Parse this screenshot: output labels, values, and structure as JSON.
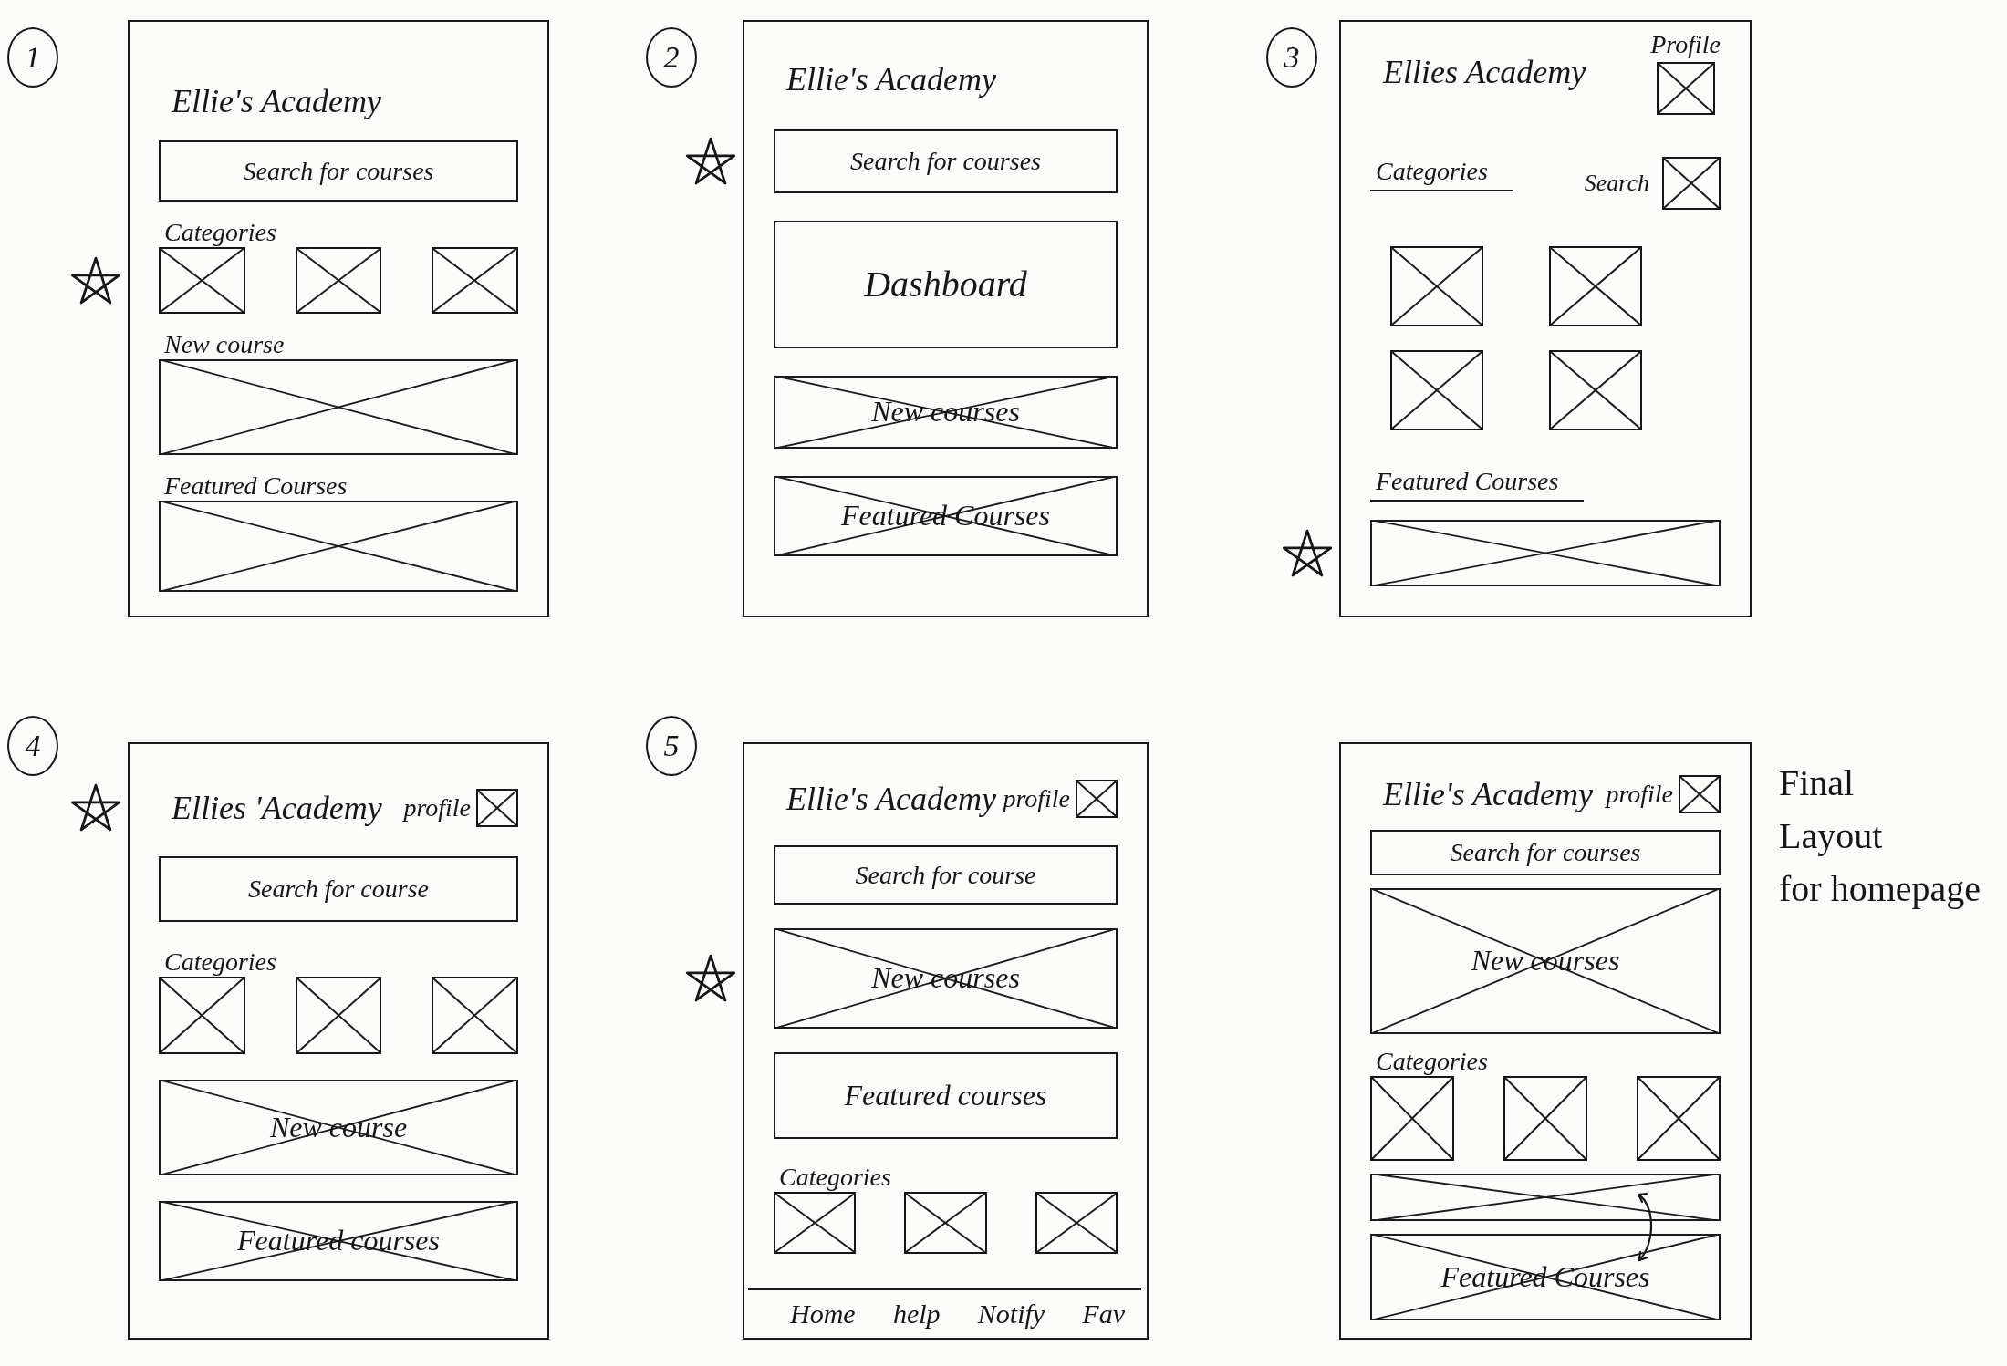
{
  "sketches": [
    {
      "number": "1",
      "sections": [
        {
          "kind": "header",
          "title": "Ellie's Academy",
          "starred": false
        },
        {
          "kind": "search",
          "placeholder": "Search for courses",
          "starred": false
        },
        {
          "kind": "tiles",
          "label": "Categories",
          "underlined": false,
          "tile_rows": [
            [
              {
                "crossed": true
              },
              {
                "crossed": true
              },
              {
                "crossed": true
              }
            ]
          ],
          "starred": true
        },
        {
          "kind": "banner",
          "label": "New course",
          "underlined": false,
          "crossed": true,
          "starred": false
        },
        {
          "kind": "banner",
          "label": "Featured Courses",
          "underlined": false,
          "crossed": true,
          "starred": false
        }
      ]
    },
    {
      "number": "2",
      "sections": [
        {
          "kind": "header",
          "title": "Ellie's Academy",
          "starred": false
        },
        {
          "kind": "search",
          "placeholder": "Search for courses",
          "starred": true
        },
        {
          "kind": "banner",
          "text": "Dashboard",
          "crossed": false,
          "starred": false
        },
        {
          "kind": "banner",
          "text": "New courses",
          "crossed": true,
          "starred": false
        },
        {
          "kind": "banner",
          "text": "Featured Courses",
          "crossed": true,
          "starred": false
        }
      ]
    },
    {
      "number": "3",
      "sections": [
        {
          "kind": "stacked_header",
          "title": "Ellies Academy",
          "profile": {
            "label": "Profile"
          },
          "starred": false
        },
        {
          "kind": "split",
          "label": "Categories",
          "underlined": true,
          "side_label": "Search",
          "starred": false
        },
        {
          "kind": "tiles",
          "tile_rows": [
            [
              {
                "crossed": true
              },
              {
                "crossed": true
              }
            ],
            [
              {
                "crossed": true
              },
              {
                "crossed": true
              }
            ]
          ],
          "starred": false
        },
        {
          "kind": "banner",
          "label": "Featured Courses",
          "underlined": true,
          "crossed": true,
          "starred": true
        }
      ]
    },
    {
      "number": "4",
      "sections": [
        {
          "kind": "header",
          "title": "Ellies 'Academy",
          "profile": {
            "label": "profile"
          },
          "starred": true
        },
        {
          "kind": "search",
          "placeholder": "Search for course",
          "starred": false
        },
        {
          "kind": "tiles",
          "label": "Categories",
          "underlined": false,
          "tile_rows": [
            [
              {
                "crossed": true
              },
              {
                "crossed": true
              },
              {
                "crossed": true
              }
            ]
          ],
          "starred": false
        },
        {
          "kind": "banner",
          "text": "New course",
          "crossed": true,
          "starred": false
        },
        {
          "kind": "banner",
          "text": "Featured courses",
          "crossed": true,
          "starred": false
        }
      ]
    },
    {
      "number": "5",
      "sections": [
        {
          "kind": "header",
          "title": "Ellie's Academy",
          "profile": {
            "label": "profile"
          },
          "starred": false
        },
        {
          "kind": "search",
          "placeholder": "Search for course",
          "starred": false
        },
        {
          "kind": "banner",
          "text": "New courses",
          "crossed": true,
          "starred": true
        },
        {
          "kind": "banner",
          "text": "Featured courses",
          "crossed": false,
          "starred": false
        },
        {
          "kind": "tiles",
          "label": "Categories",
          "underlined": false,
          "tile_rows": [
            [
              {
                "crossed": true
              },
              {
                "crossed": true
              },
              {
                "crossed": true
              }
            ]
          ],
          "starred": false
        },
        {
          "kind": "nav",
          "items": [
            "Home",
            "help",
            "Notify",
            "Fav"
          ],
          "starred": false
        }
      ]
    },
    {
      "sections": [
        {
          "kind": "header",
          "title": "Ellie's Academy",
          "profile": {
            "label": "profile"
          },
          "starred": false
        },
        {
          "kind": "search",
          "placeholder": "Search for courses",
          "starred": false
        },
        {
          "kind": "banner",
          "text": "New courses",
          "crossed": true,
          "starred": false
        },
        {
          "kind": "tiles",
          "label": "Categories",
          "underlined": false,
          "tile_rows": [
            [
              {
                "crossed": true
              },
              {
                "crossed": true
              },
              {
                "crossed": true
              }
            ]
          ],
          "starred": false
        },
        {
          "kind": "banner",
          "crossed": true,
          "swap_marker": true,
          "starred": false
        },
        {
          "kind": "banner",
          "text": "Featured Courses",
          "crossed": true,
          "starred": false
        }
      ],
      "note_lines": [
        "Final",
        "Layout",
        "for homepage"
      ]
    }
  ]
}
